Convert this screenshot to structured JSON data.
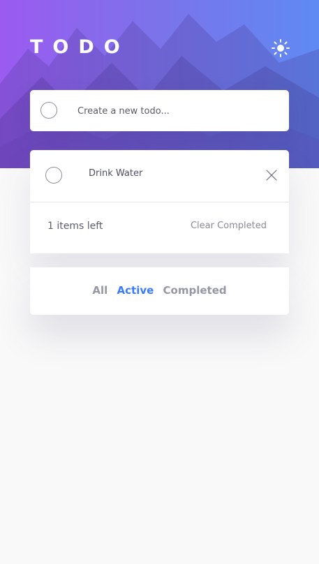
{
  "header": {
    "title": "TODO",
    "theme_icon": "sun-icon"
  },
  "new_todo": {
    "placeholder": "Create a new todo..."
  },
  "todos": [
    {
      "text": "Drink Water",
      "completed": false
    }
  ],
  "footer": {
    "items_left": "1 items left",
    "clear_label": "Clear Completed"
  },
  "filters": {
    "all": "All",
    "active": "Active",
    "completed": "Completed",
    "selected": "Active"
  },
  "colors": {
    "accent": "#3a7bfd",
    "gradient_start": "#9b5bf0",
    "gradient_end": "#5f8af3"
  }
}
